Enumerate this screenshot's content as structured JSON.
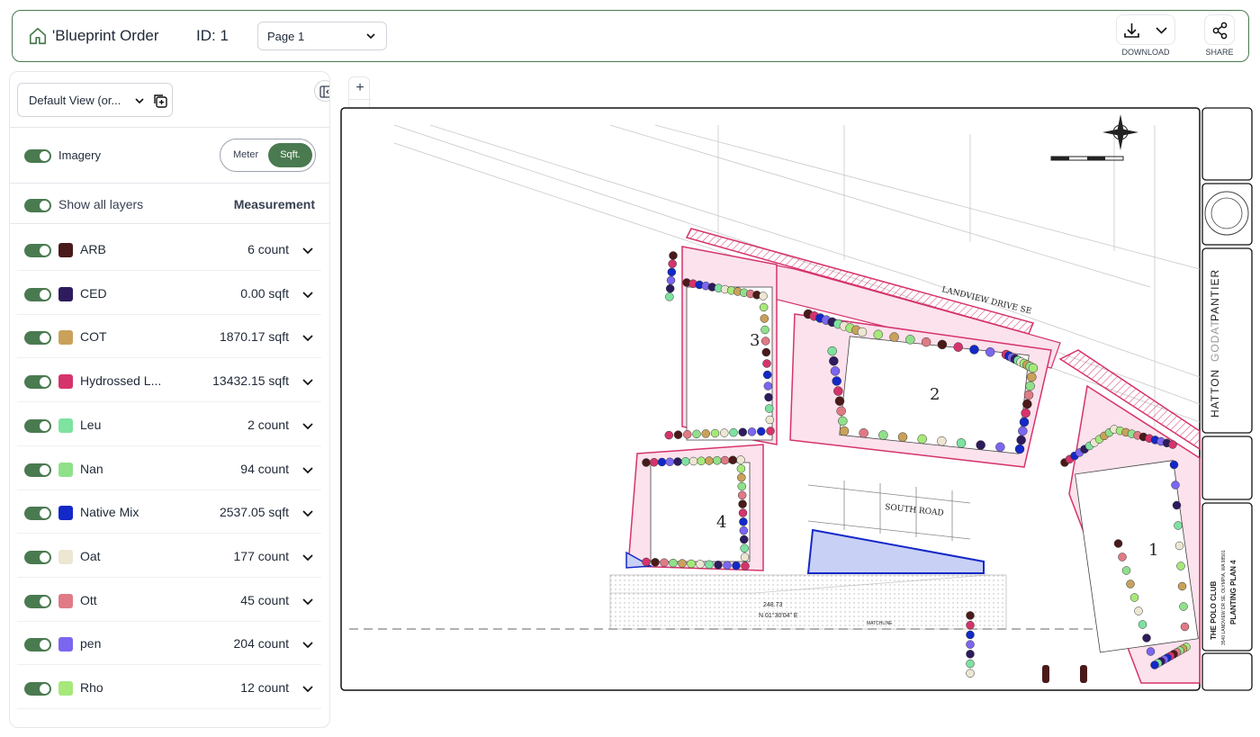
{
  "header": {
    "title": "'Blueprint Order",
    "order_id": "ID: 1",
    "page_select": "Page 1",
    "download_label": "DOWNLOAD",
    "share_label": "SHARE"
  },
  "panel": {
    "view_select": "Default View (or...",
    "imagery_label": "Imagery",
    "units": {
      "option1": "Meter",
      "option2": "Sqft.",
      "selected": "Sqft."
    },
    "show_all_label": "Show all layers",
    "measurement_header": "Measurement",
    "layers": [
      {
        "name": "ARB",
        "value": "6 count",
        "color": "#4a1a1a"
      },
      {
        "name": "CED",
        "value": "0.00 sqft",
        "color": "#2d1b5e"
      },
      {
        "name": "COT",
        "value": "1870.17 sqft",
        "color": "#c9a15a"
      },
      {
        "name": "Hydrossed L...",
        "value": "13432.15 sqft",
        "color": "#d6336c"
      },
      {
        "name": "Leu",
        "value": "2 count",
        "color": "#7ee2a0"
      },
      {
        "name": "Nan",
        "value": "94 count",
        "color": "#90e08a"
      },
      {
        "name": "Native Mix",
        "value": "2537.05 sqft",
        "color": "#1328c8"
      },
      {
        "name": "Oat",
        "value": "177 count",
        "color": "#ece6d2"
      },
      {
        "name": "Ott",
        "value": "45 count",
        "color": "#e07a85"
      },
      {
        "name": "pen",
        "value": "204 count",
        "color": "#7b66f0"
      },
      {
        "name": "Rho",
        "value": "12 count",
        "color": "#a6e87a"
      }
    ]
  },
  "zoom": {
    "in": "+",
    "out": "−"
  },
  "blueprint": {
    "street_top": "LANDVIEW DRIVE SE",
    "street_mid": "SOUTH ROAD",
    "buildings": [
      "1",
      "2",
      "3",
      "4"
    ],
    "bearing": "N 01°30'04\" E",
    "distance": "248.73",
    "matchline": "MATCHLINE",
    "title_block": {
      "firm1": "HATTON",
      "firm2": "GODAT",
      "firm3": "PANTIER",
      "project": "THE POLO CLUB",
      "address": "3540 LANDVIEW DR SE, OLYMPIA, WA 98501",
      "sheet_title": "PLANTING PLAN 4"
    }
  }
}
